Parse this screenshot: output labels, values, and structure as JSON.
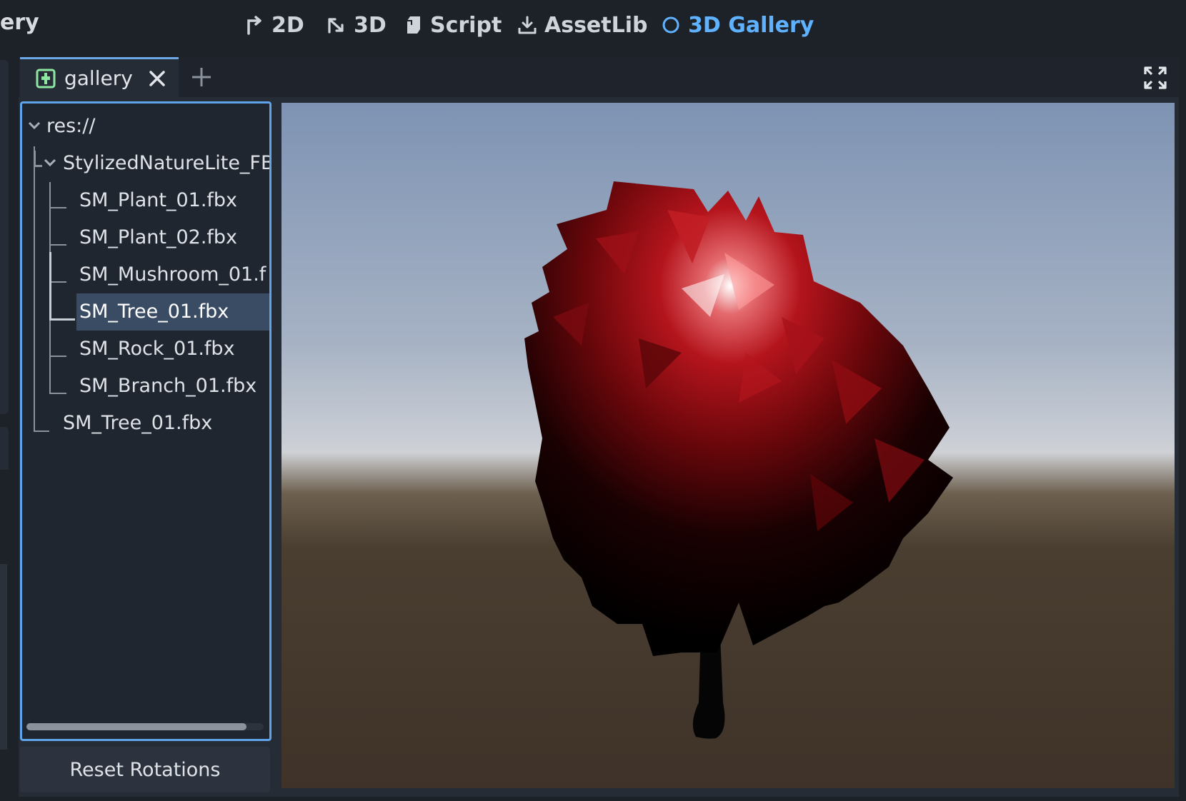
{
  "app": {
    "title_fragment": "ery"
  },
  "workspace_tabs": [
    {
      "label": "2D",
      "icon": "2d-icon",
      "active": false
    },
    {
      "label": "3D",
      "icon": "3d-icon",
      "active": false
    },
    {
      "label": "Script",
      "icon": "script-icon",
      "active": false
    },
    {
      "label": "AssetLib",
      "icon": "assetlib-icon",
      "active": false
    },
    {
      "label": "3D Gallery",
      "icon": "plugin-circle-icon",
      "active": true
    }
  ],
  "scene_tabs": [
    {
      "label": "gallery",
      "icon": "scene-icon"
    }
  ],
  "tree": {
    "root": "res://",
    "folder": "StylizedNatureLite_FB",
    "children": [
      "SM_Plant_01.fbx",
      "SM_Plant_02.fbx",
      "SM_Mushroom_01.f",
      "SM_Tree_01.fbx",
      "SM_Rock_01.fbx",
      "SM_Branch_01.fbx"
    ],
    "selected_index": 3,
    "root_file": "SM_Tree_01.fbx"
  },
  "buttons": {
    "reset": "Reset Rotations"
  },
  "colors": {
    "accent": "#5fb2ff",
    "selection": "#3a4c64",
    "foliage": "#b0121a",
    "panel": "#262c35"
  }
}
